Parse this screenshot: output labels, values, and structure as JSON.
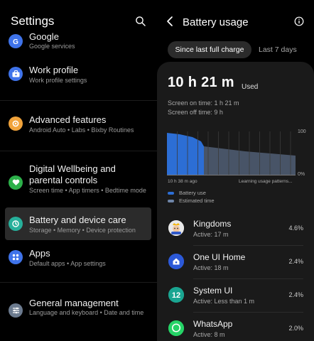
{
  "settings": {
    "title": "Settings",
    "items": [
      {
        "title": "Google",
        "subtitle": "Google services",
        "icon": "google-icon",
        "color": "#3f73ea"
      },
      {
        "title": "Work profile",
        "subtitle": "Work profile settings",
        "icon": "briefcase-icon",
        "color": "#3f73ea"
      },
      {
        "title": "Advanced features",
        "subtitle": "Android Auto  •  Labs  •  Bixby Routines",
        "icon": "gear-plus-icon",
        "color": "#f1a33b"
      },
      {
        "title": "Digital Wellbeing and parental controls",
        "subtitle": "Screen time  •  App timers  •  Bedtime mode",
        "icon": "heart-icon",
        "color": "#2db04a"
      },
      {
        "title": "Battery and device care",
        "subtitle": "Storage  •  Memory  •  Device protection",
        "icon": "device-care-icon",
        "color": "#27b09b"
      },
      {
        "title": "Apps",
        "subtitle": "Default apps  •  App settings",
        "icon": "apps-icon",
        "color": "#3f73ea"
      },
      {
        "title": "General management",
        "subtitle": "Language and keyboard  •  Date and time",
        "icon": "sliders-icon",
        "color": "#6c7b8f"
      }
    ]
  },
  "battery": {
    "title": "Battery usage",
    "tabs": {
      "active": "Since last full charge",
      "other": "Last 7 days"
    },
    "used_time": "10 h 21 m",
    "used_label": "Used",
    "screen_on": "Screen on time: 1 h 21 m",
    "screen_off": "Screen off time: 9 h",
    "chart": {
      "y_max_label": "100",
      "y_min_label": "0%",
      "x_start_label": "10 h 38 m ago",
      "x_end_label": "Learning usage patterns...",
      "used_color": "#2c6ed5",
      "estimated_color": "#6f85a8"
    },
    "legend": {
      "used": "Battery use",
      "estimated": "Estimated time"
    },
    "apps": [
      {
        "name": "Kingdoms",
        "active": "Active: 17 m",
        "percent": "4.6%",
        "icon": "kingdoms-game-icon"
      },
      {
        "name": "One UI Home",
        "active": "Active: 18 m",
        "percent": "2.4%",
        "icon": "one-ui-home-icon"
      },
      {
        "name": "System UI",
        "active": "Active: Less than 1 m",
        "percent": "2.4%",
        "icon": "system-ui-icon"
      },
      {
        "name": "WhatsApp",
        "active": "Active: 8 m",
        "percent": "2.0%",
        "icon": "whatsapp-icon"
      }
    ]
  }
}
